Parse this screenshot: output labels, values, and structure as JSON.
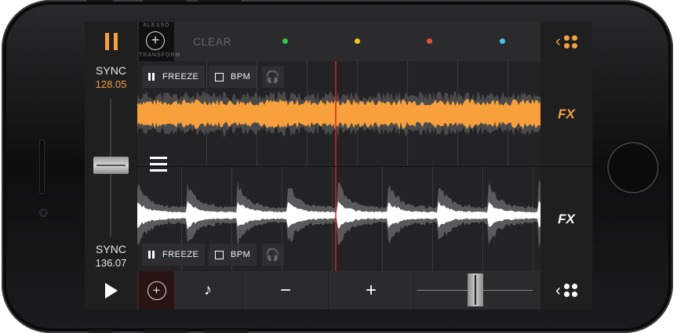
{
  "topbar": {
    "effect_caption_top": "ALESSO",
    "effect_caption_bottom": "TRANSFORM",
    "clear_label": "CLEAR",
    "pad_colors": [
      "#2ecc40",
      "#f1c40f",
      "#e74c3c",
      "#3fc6f0"
    ]
  },
  "deck_a": {
    "sync_label": "SYNC",
    "bpm": "128.05",
    "freeze_label": "FREEZE",
    "bpm_label": "BPM",
    "fx_label": "FX",
    "waveform_color": "#f7a03c"
  },
  "deck_b": {
    "sync_label": "SYNC",
    "bpm": "136.07",
    "freeze_label": "FREEZE",
    "bpm_label": "BPM",
    "fx_label": "FX",
    "waveform_color": "#ffffff"
  },
  "bottombar": {
    "minus_label": "−",
    "plus_label": "+"
  },
  "colors": {
    "accent": "#f5a040",
    "playhead": "#e02020"
  }
}
